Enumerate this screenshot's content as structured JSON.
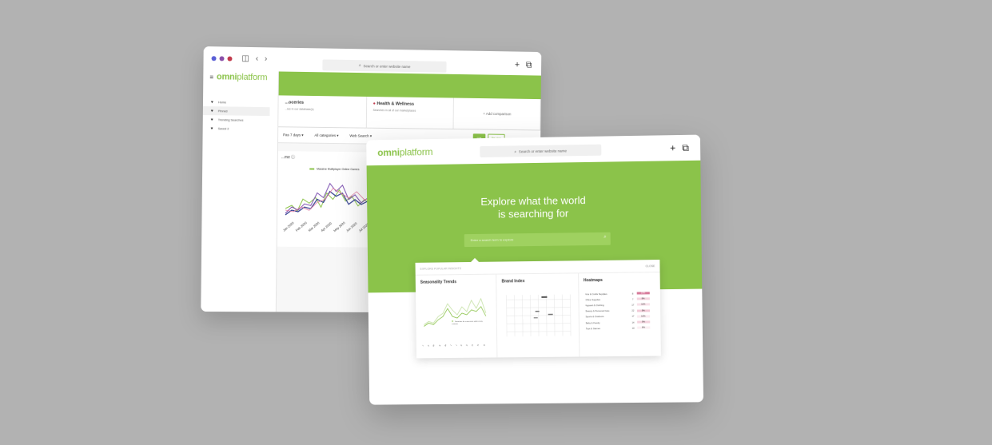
{
  "back_window": {
    "address_placeholder": "Search or enter website name",
    "logo": {
      "bold": "omni",
      "light": "platform"
    },
    "sidebar_items": [
      "Home",
      "Pinned",
      "Trending Searches",
      "Saved 2"
    ],
    "cards": [
      {
        "title": "...oceries",
        "subtitle": "...ies in our database(s)"
      },
      {
        "title": "Health & Wellness",
        "subtitle": "Searches in all of our marketplaces"
      },
      {
        "title": "+ Add comparison"
      }
    ],
    "filters": [
      "Pas 7 days ▾",
      "All categories ▾",
      "Web Search ▾"
    ],
    "toggles": [
      "Line",
      "Bar chart"
    ],
    "chart": {
      "title": "...me ⓘ",
      "legend": "Massive Multiplayer Online Games",
      "x_labels": [
        "Jan 2020",
        "Feb 2020",
        "Mar 2020",
        "Apr 2020",
        "May 2020",
        "Jun 2020",
        "Jul 2020"
      ]
    }
  },
  "front_window": {
    "address_placeholder": "Search or enter website name",
    "logo": {
      "bold": "omni",
      "light": "platform"
    },
    "hero_title_line1": "Explore what the world",
    "hero_title_line2": "is searching for",
    "search_placeholder": "Enter a search term to explore",
    "dropdown": {
      "header": "EXPLORE POPULAR INSIGHTS",
      "close": "CLOSE",
      "columns": [
        {
          "title": "Seasonality Trends",
          "callout": "Searches for sunscreen spike every summer"
        },
        {
          "title": "Brand Index"
        },
        {
          "title": "Heatmaps",
          "rows": [
            {
              "name": "Arts & Crafts Supplies",
              "value": "8",
              "pct": "10%"
            },
            {
              "name": "Office Supplies",
              "value": "7",
              "pct": "8%"
            },
            {
              "name": "Apparel & Clothing",
              "value": "17",
              "pct": "11%"
            },
            {
              "name": "Beauty & Personal Care",
              "value": "22",
              "pct": "9%"
            },
            {
              "name": "Sports & Outdoors",
              "value": "17",
              "pct": "10%"
            },
            {
              "name": "Baby & Family",
              "value": "14",
              "pct": "9%"
            },
            {
              "name": "Toys & Games",
              "value": "10",
              "pct": "8%"
            }
          ]
        }
      ],
      "month_ticks": [
        "J",
        "F",
        "M",
        "A",
        "M",
        "J",
        "J",
        "A",
        "S",
        "O",
        "N",
        "D"
      ]
    }
  },
  "colors": {
    "brand_green": "#8bc34a",
    "background": "#b2b2b2",
    "heat_dark": "#d77a9a",
    "heat_light": "#f4d3de"
  }
}
